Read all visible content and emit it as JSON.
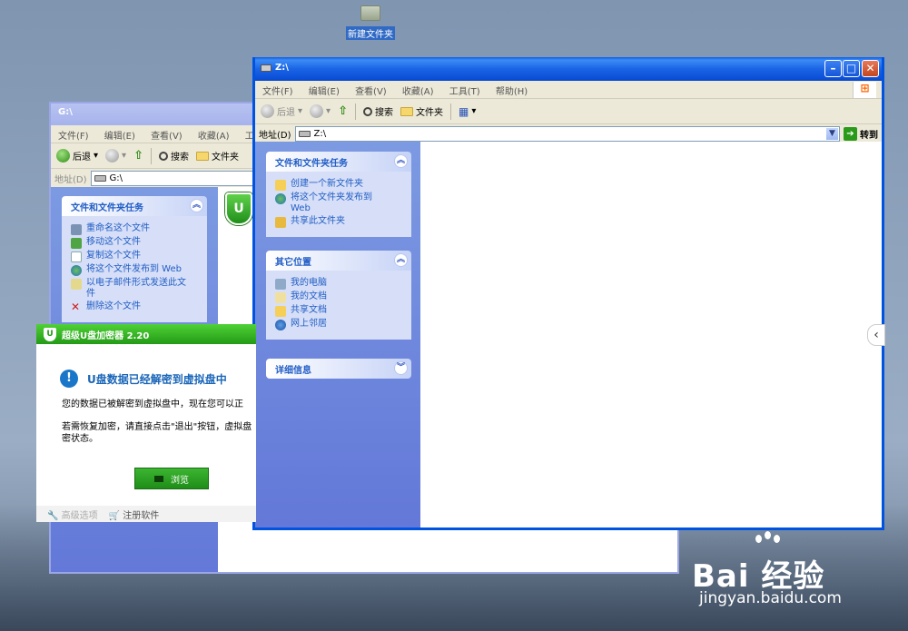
{
  "desktop": {
    "folder_label": "新建文件夹"
  },
  "back_window": {
    "title": "G:\\",
    "menu": [
      "文件(F)",
      "编辑(E)",
      "查看(V)",
      "收藏(A)",
      "工"
    ],
    "toolbar": {
      "back": "后退",
      "search": "搜索",
      "folders": "文件夹"
    },
    "address_label": "地址(D)",
    "address_value": "G:\\",
    "tasks_title": "文件和文件夹任务",
    "tasks": [
      "重命名这个文件",
      "移动这个文件",
      "复制这个文件",
      "将这个文件发布到 Web",
      "以电子邮件形式发送此文件",
      "删除这个文件"
    ]
  },
  "front_window": {
    "title": "Z:\\",
    "menu": [
      "文件(F)",
      "编辑(E)",
      "查看(V)",
      "收藏(A)",
      "工具(T)",
      "帮助(H)"
    ],
    "toolbar": {
      "back": "后退",
      "search": "搜索",
      "folders": "文件夹"
    },
    "address_label": "地址(D)",
    "address_value": "Z:\\",
    "go_label": "转到",
    "tasks_title": "文件和文件夹任务",
    "tasks": [
      "创建一个新文件夹",
      "将这个文件夹发布到Web",
      "共享此文件夹"
    ],
    "places_title": "其它位置",
    "places": [
      "我的电脑",
      "我的文档",
      "共享文档",
      "网上邻居"
    ],
    "details_title": "详细信息"
  },
  "dialog": {
    "title": "超级U盘加密器 2.20",
    "heading": "U盘数据已经解密到虚拟盘中",
    "line1": "您的数据已被解密到虚拟盘中，现在您可以正",
    "line2": "若需恢复加密，请直接点击\"退出\"按钮，虚拟盘",
    "line3": "密状态。",
    "browse": "浏览",
    "advanced": "高级选项",
    "register": "注册软件"
  },
  "watermark": {
    "brand": "Bai  经验",
    "url": "jingyan.baidu.com"
  }
}
